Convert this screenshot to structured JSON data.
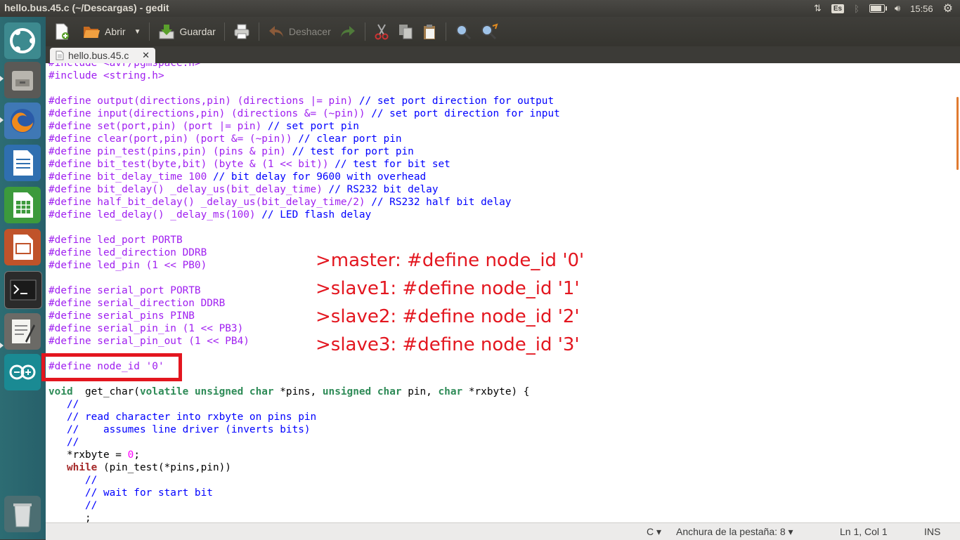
{
  "window": {
    "title": "hello.bus.45.c (~/Descargas) - gedit"
  },
  "panel": {
    "keyboard": "Es",
    "time": "15:56",
    "battery_level": 0.75
  },
  "toolbar": {
    "new_label": "",
    "open_label": "Abrir",
    "save_label": "Guardar",
    "undo_label": "Deshacer"
  },
  "tab": {
    "label": "hello.bus.45.c",
    "close": "✕"
  },
  "code": [
    [
      [
        "pp",
        "#include <avr/pgmspace.h>"
      ]
    ],
    [
      [
        "pp",
        "#include <string.h>"
      ]
    ],
    [],
    [
      [
        "pp",
        "#define output(directions,pin) (directions |= pin) "
      ],
      [
        "cm",
        "// set port direction for output"
      ]
    ],
    [
      [
        "pp",
        "#define input(directions,pin) (directions &= (~pin)) "
      ],
      [
        "cm",
        "// set port direction for input"
      ]
    ],
    [
      [
        "pp",
        "#define set(port,pin) (port |= pin) "
      ],
      [
        "cm",
        "// set port pin"
      ]
    ],
    [
      [
        "pp",
        "#define clear(port,pin) (port &= (~pin)) "
      ],
      [
        "cm",
        "// clear port pin"
      ]
    ],
    [
      [
        "pp",
        "#define pin_test(pins,pin) (pins & pin) "
      ],
      [
        "cm",
        "// test for port pin"
      ]
    ],
    [
      [
        "pp",
        "#define bit_test(byte,bit) (byte & (1 << bit)) "
      ],
      [
        "cm",
        "// test for bit set"
      ]
    ],
    [
      [
        "pp",
        "#define bit_delay_time 100 "
      ],
      [
        "cm",
        "// bit delay for 9600 with overhead"
      ]
    ],
    [
      [
        "pp",
        "#define bit_delay() _delay_us(bit_delay_time) "
      ],
      [
        "cm",
        "// RS232 bit delay"
      ]
    ],
    [
      [
        "pp",
        "#define half_bit_delay() _delay_us(bit_delay_time/2) "
      ],
      [
        "cm",
        "// RS232 half bit delay"
      ]
    ],
    [
      [
        "pp",
        "#define led_delay() _delay_ms(100) "
      ],
      [
        "cm",
        "// LED flash delay"
      ]
    ],
    [],
    [
      [
        "pp",
        "#define led_port PORTB"
      ]
    ],
    [
      [
        "pp",
        "#define led_direction DDRB"
      ]
    ],
    [
      [
        "pp",
        "#define led_pin (1 << PB0)"
      ]
    ],
    [],
    [
      [
        "pp",
        "#define serial_port PORTB"
      ]
    ],
    [
      [
        "pp",
        "#define serial_direction DDRB"
      ]
    ],
    [
      [
        "pp",
        "#define serial_pins PINB"
      ]
    ],
    [
      [
        "pp",
        "#define serial_pin_in (1 << PB3)"
      ]
    ],
    [
      [
        "pp",
        "#define serial_pin_out (1 << PB4)"
      ]
    ],
    [],
    [
      [
        "pp",
        "#define node_id '0'"
      ]
    ],
    [],
    [
      [
        "ty",
        "void"
      ],
      [
        "",
        "  get_char("
      ],
      [
        "ty",
        "volatile unsigned char"
      ],
      [
        "",
        " *pins, "
      ],
      [
        "ty",
        "unsigned char"
      ],
      [
        "",
        " pin, "
      ],
      [
        "ty",
        "char"
      ],
      [
        "",
        " *rxbyte) {"
      ]
    ],
    [
      [
        "",
        "   "
      ],
      [
        "cm",
        "//"
      ]
    ],
    [
      [
        "",
        "   "
      ],
      [
        "cm",
        "// read character into rxbyte on pins pin"
      ]
    ],
    [
      [
        "",
        "   "
      ],
      [
        "cm",
        "//    assumes line driver (inverts bits)"
      ]
    ],
    [
      [
        "",
        "   "
      ],
      [
        "cm",
        "//"
      ]
    ],
    [
      [
        "",
        "   *rxbyte = "
      ],
      [
        "nm",
        "0"
      ],
      [
        "",
        ";"
      ]
    ],
    [
      [
        "",
        "   "
      ],
      [
        "kw",
        "while"
      ],
      [
        "",
        " (pin_test(*pins,pin))"
      ]
    ],
    [
      [
        "",
        "      "
      ],
      [
        "cm",
        "//"
      ]
    ],
    [
      [
        "",
        "      "
      ],
      [
        "cm",
        "// wait for start bit"
      ]
    ],
    [
      [
        "",
        "      "
      ],
      [
        "cm",
        "//"
      ]
    ],
    [
      [
        "",
        "      ;"
      ]
    ]
  ],
  "annotations": [
    ">master: #define node_id '0'",
    ">slave1: #define node_id '1'",
    ">slave2: #define node_id '2'",
    ">slave3: #define node_id '3'"
  ],
  "status": {
    "language": "C ▾",
    "tab_width": "Anchura de la pestaña: 8 ▾",
    "position": "Ln 1, Col 1",
    "mode": "INS"
  },
  "colors": {
    "annotation": "#e3161f",
    "launcher": "#2d6c73"
  }
}
